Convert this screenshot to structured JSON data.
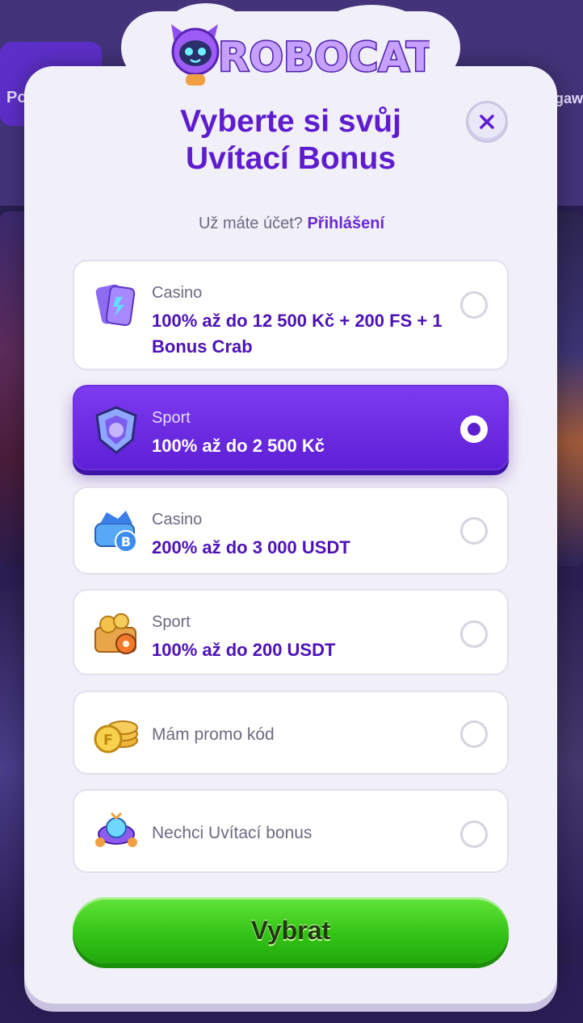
{
  "background": {
    "top_left_button_label": "Po",
    "top_right_text": "gaw"
  },
  "brand": {
    "logo_text": "ROBOCAT"
  },
  "modal": {
    "title_line1": "Vyberte si svůj",
    "title_line2": "Uvítací Bonus",
    "account_question": "Už máte účet?",
    "login_link": "Přihlášení",
    "close_icon": "close-icon"
  },
  "options": [
    {
      "category": "Casino",
      "description": "100% až do 12 500 Kč + 200 FS + 1 Bonus Crab",
      "icon": "casino-cards-icon",
      "selected": false
    },
    {
      "category": "Sport",
      "description": "100% až do 2 500 Kč",
      "icon": "sport-shield-icon",
      "selected": true
    },
    {
      "category": "Casino",
      "description": "200% až do 3 000 USDT",
      "icon": "crypto-casino-icon",
      "selected": false
    },
    {
      "category": "Sport",
      "description": "100% až do 200 USDT",
      "icon": "crypto-sport-icon",
      "selected": false
    },
    {
      "category": "",
      "description": "Mám promo kód",
      "icon": "promo-coins-icon",
      "selected": false
    },
    {
      "category": "",
      "description": "Nechci Uvítací bonus",
      "icon": "no-bonus-icon",
      "selected": false
    }
  ],
  "submit_label": "Vybrat",
  "colors": {
    "accent_purple": "#5e1ccf",
    "selected_bg": "#6a2ce4",
    "submit_green": "#34c417"
  }
}
